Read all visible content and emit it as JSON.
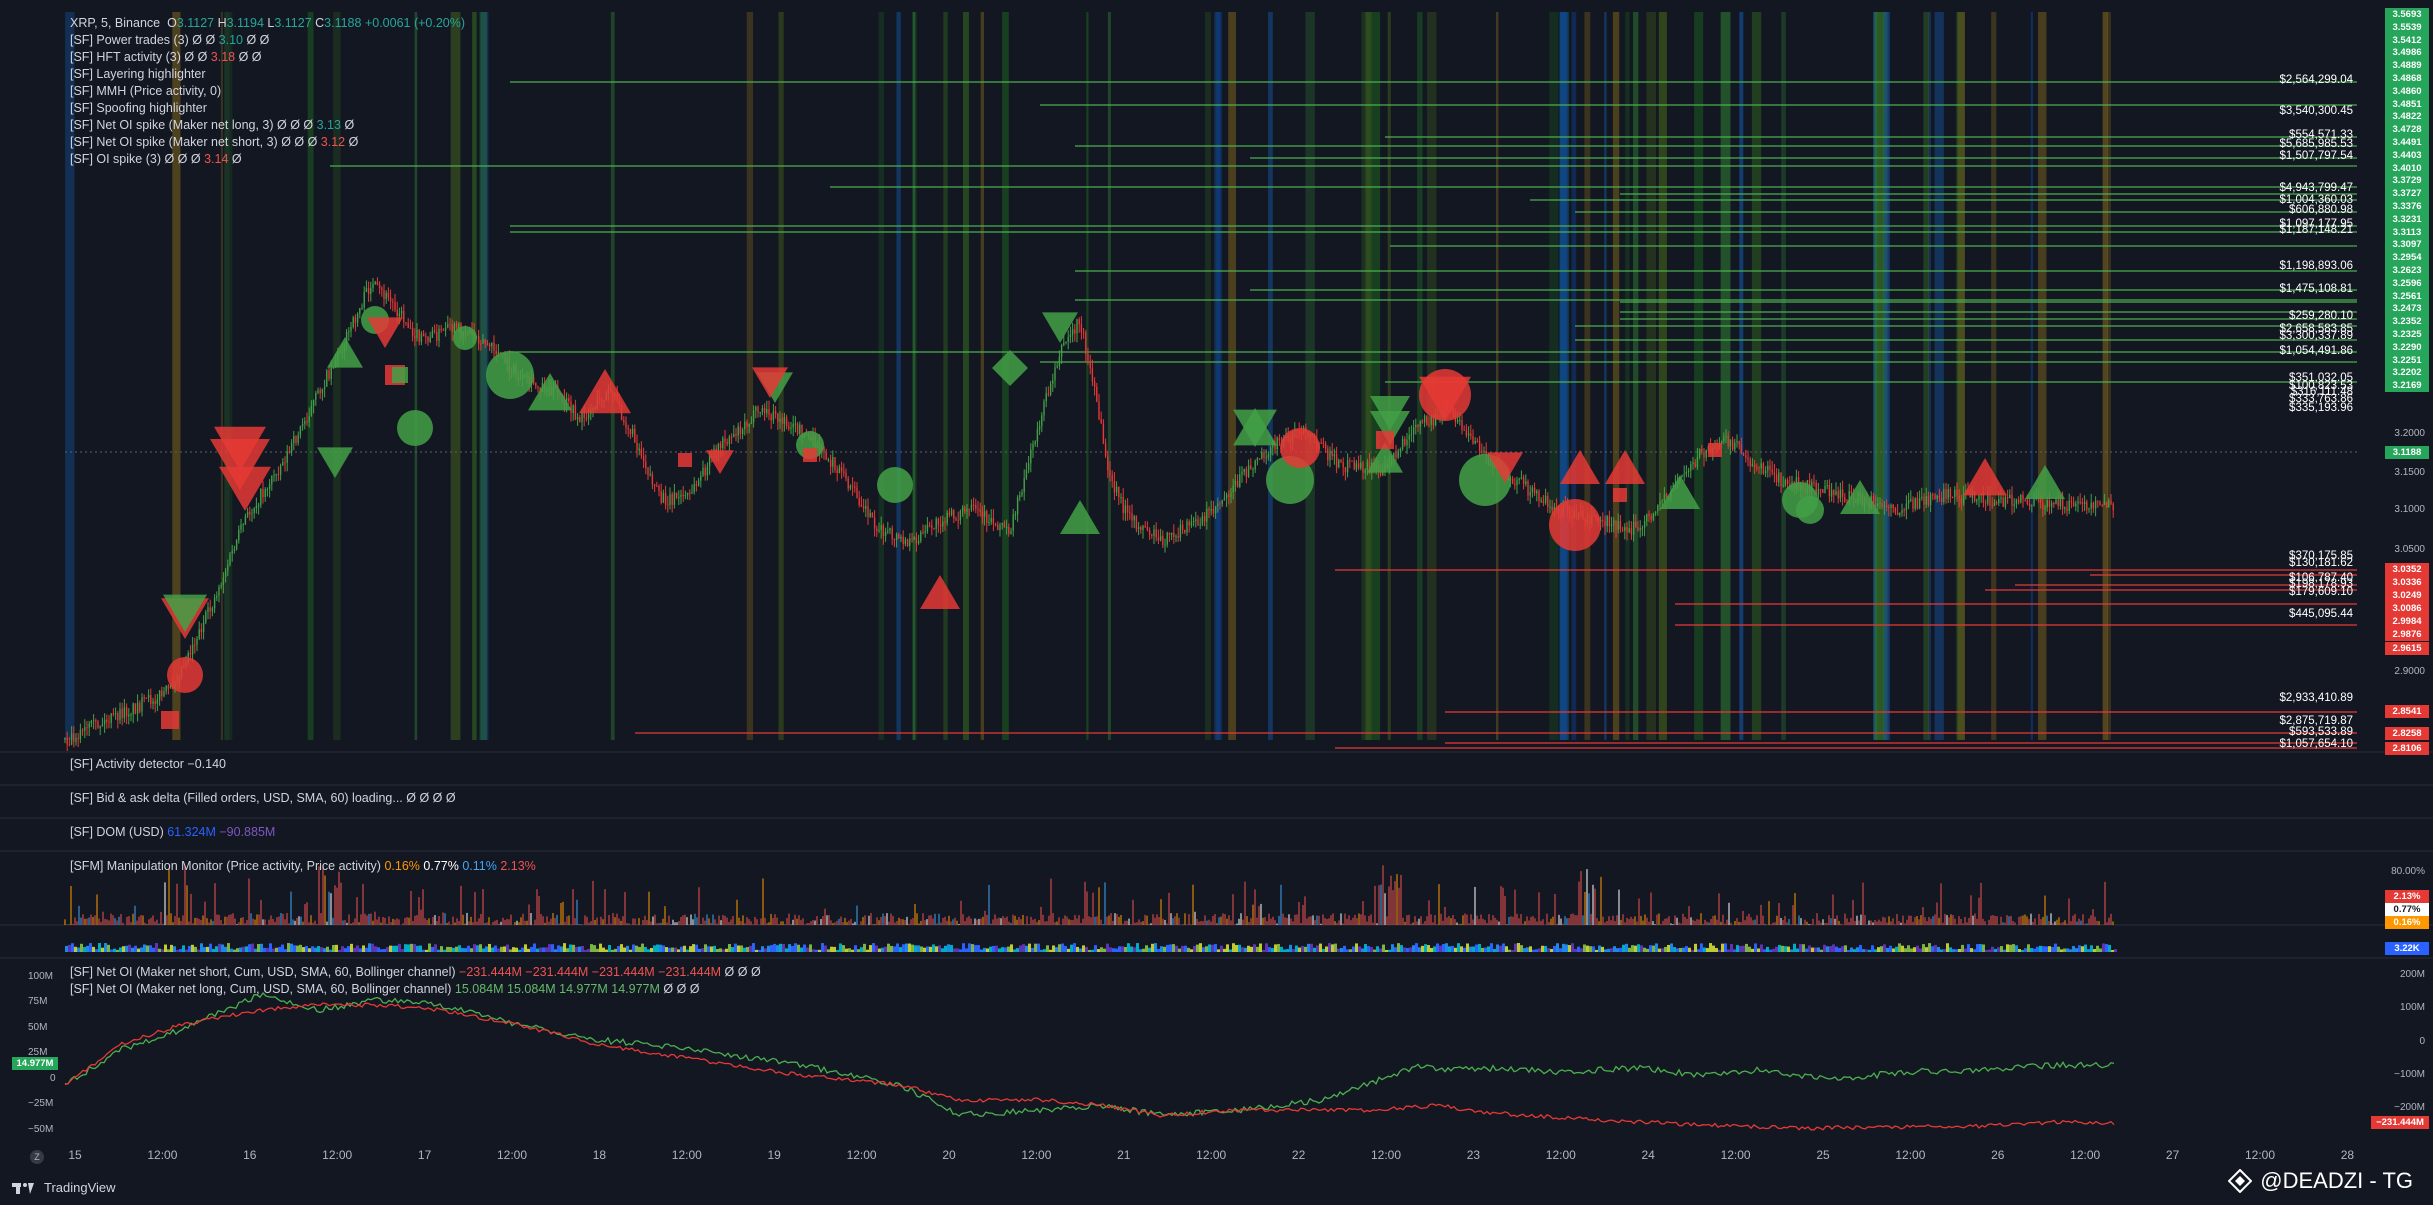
{
  "header": {
    "symbol": "XRP, 5, Binance",
    "ohlc": [
      {
        "k": "O",
        "v": "3.1127"
      },
      {
        "k": "H",
        "v": "3.1194"
      },
      {
        "k": "L",
        "v": "3.1127"
      },
      {
        "k": "C",
        "v": "3.1188"
      }
    ],
    "change": "+0.0061 (+0.20%)"
  },
  "indicators": [
    {
      "name": "[SF] Power trades (3)",
      "vals": [
        {
          "t": "Ø Ø",
          "c": "n"
        },
        {
          "t": "3.10",
          "c": "g"
        },
        {
          "t": "Ø Ø",
          "c": "n"
        }
      ]
    },
    {
      "name": "[SF] HFT activity (3)",
      "vals": [
        {
          "t": "Ø Ø",
          "c": "n"
        },
        {
          "t": "3.18",
          "c": "r"
        },
        {
          "t": "Ø Ø",
          "c": "n"
        }
      ]
    },
    {
      "name": "[SF] Layering highlighter",
      "vals": []
    },
    {
      "name": "[SF] MMH (Price activity, 0)",
      "vals": []
    },
    {
      "name": "[SF] Spoofing highlighter",
      "vals": []
    },
    {
      "name": "[SF] Net OI spike (Maker net long, 3)",
      "vals": [
        {
          "t": "Ø Ø Ø",
          "c": "n"
        },
        {
          "t": "3.13",
          "c": "g"
        },
        {
          "t": "Ø",
          "c": "n"
        }
      ]
    },
    {
      "name": "[SF] Net OI spike (Maker net short, 3)",
      "vals": [
        {
          "t": "Ø Ø Ø",
          "c": "n"
        },
        {
          "t": "3.12",
          "c": "r"
        },
        {
          "t": "Ø",
          "c": "n"
        }
      ]
    },
    {
      "name": "[SF] OI spike (3)",
      "vals": [
        {
          "t": "Ø Ø Ø",
          "c": "n"
        },
        {
          "t": "3.14",
          "c": "r"
        },
        {
          "t": "Ø",
          "c": "n"
        }
      ]
    }
  ],
  "panes": {
    "activity": {
      "title": "[SF] Activity detector",
      "value": "−0.140"
    },
    "bidask": {
      "title": "[SF] Bid & ask delta (Filled orders, USD, SMA, 60) loading...",
      "value": "Ø Ø Ø Ø"
    },
    "dom": {
      "title": "[SF] DOM (USD)",
      "v1": "61.324M",
      "v2": "−90.885M"
    },
    "manip": {
      "title": "[SFM] Manipulation Monitor (Price activity, Price activity)",
      "v1": "0.16%",
      "v2": "0.77%",
      "v3": "0.11%",
      "v4": "2.13%"
    },
    "netoi_short": {
      "title": "[SF] Net OI (Maker net short, Cum, USD, SMA, 60, Bollinger channel)",
      "values": "−231.444M −231.444M −231.444M −231.444M",
      "tail": "Ø Ø Ø"
    },
    "netoi_long": {
      "title": "[SF] Net OI (Maker net long, Cum, USD, SMA, 60, Bollinger channel)",
      "values": "15.084M 15.084M 14.977M 14.977M",
      "tail": "Ø Ø Ø"
    }
  },
  "price_axis": {
    "green_tags": [
      "3.5693",
      "3.5539",
      "3.5412",
      "3.4986",
      "3.4889",
      "3.4868",
      "3.4860",
      "3.4851",
      "3.4822",
      "3.4728",
      "3.4491",
      "3.4403",
      "3.4010",
      "3.3729",
      "3.3727",
      "3.3376",
      "3.3231",
      "3.3113",
      "3.3097",
      "3.2954",
      "3.2623",
      "3.2596",
      "3.2561",
      "3.2473",
      "3.2352",
      "3.2325",
      "3.2290",
      "3.2251",
      "3.2202",
      "3.2169"
    ],
    "current": "3.1188",
    "red_tags": [
      "3.0352",
      "3.0336",
      "3.0249",
      "3.0086",
      "2.9984",
      "2.9876",
      "2.9615",
      "2.8541",
      "2.8258",
      "2.8106"
    ],
    "plain_ticks": [
      "3.2000",
      "3.1500",
      "3.1000",
      "3.0500",
      "2.9000"
    ],
    "manip_ticks": [
      "80.00%"
    ],
    "manip_tags": [
      "2.13%",
      "0.77%",
      "0.16%"
    ],
    "dom_tag": "3.22K",
    "oi_ticks_right": [
      "200M",
      "100M",
      "0",
      "−100M",
      "−200M"
    ],
    "oi_tag_right": "−231.444M",
    "oi_ticks_left": [
      "100M",
      "75M",
      "50M",
      "25M",
      "0",
      "−25M",
      "−50M"
    ],
    "oi_tag_left": "14.977M"
  },
  "levels": {
    "green": [
      "$2,564,299.04",
      "$3,540,300.45",
      "$554,571.33",
      "$5,685,985.53",
      "$1,507,797.54",
      "$4,943,799.47",
      "$1,004,360.03",
      "$606,880.98",
      "$1,097,177.95",
      "$1,187,148.21",
      "$1,198,893.06",
      "$1,475,108.81",
      "$259,280.10",
      "$2,658,583.85",
      "$3,300,337.89",
      "$1,054,491.86",
      "$351,032.05",
      "$100,823.53",
      "$316,111.48",
      "$333,763.86",
      "$335,193.96"
    ],
    "red": [
      "$370,175.85",
      "$130,181.62",
      "$106,787.40",
      "$198,178.93",
      "$179,609.10",
      "$445,095.44",
      "$2,933,410.89",
      "$2,875,719.87",
      "$593,533.89",
      "$1,057,654.10"
    ]
  },
  "time_axis": [
    "15",
    "12:00",
    "16",
    "12:00",
    "17",
    "12:00",
    "18",
    "12:00",
    "19",
    "12:00",
    "20",
    "12:00",
    "21",
    "12:00",
    "22",
    "12:00",
    "23",
    "12:00",
    "24",
    "12:00",
    "25",
    "12:00",
    "26",
    "12:00",
    "27",
    "12:00",
    "28"
  ],
  "footer": {
    "brand": "TradingView",
    "watermark": "@DEADZI - TG"
  },
  "colors": {
    "bg": "#131722",
    "green": "#26a65b",
    "red": "#e53935",
    "candle_up": "#43a047",
    "candle_down": "#e53935",
    "grid": "#2a2e39"
  }
}
